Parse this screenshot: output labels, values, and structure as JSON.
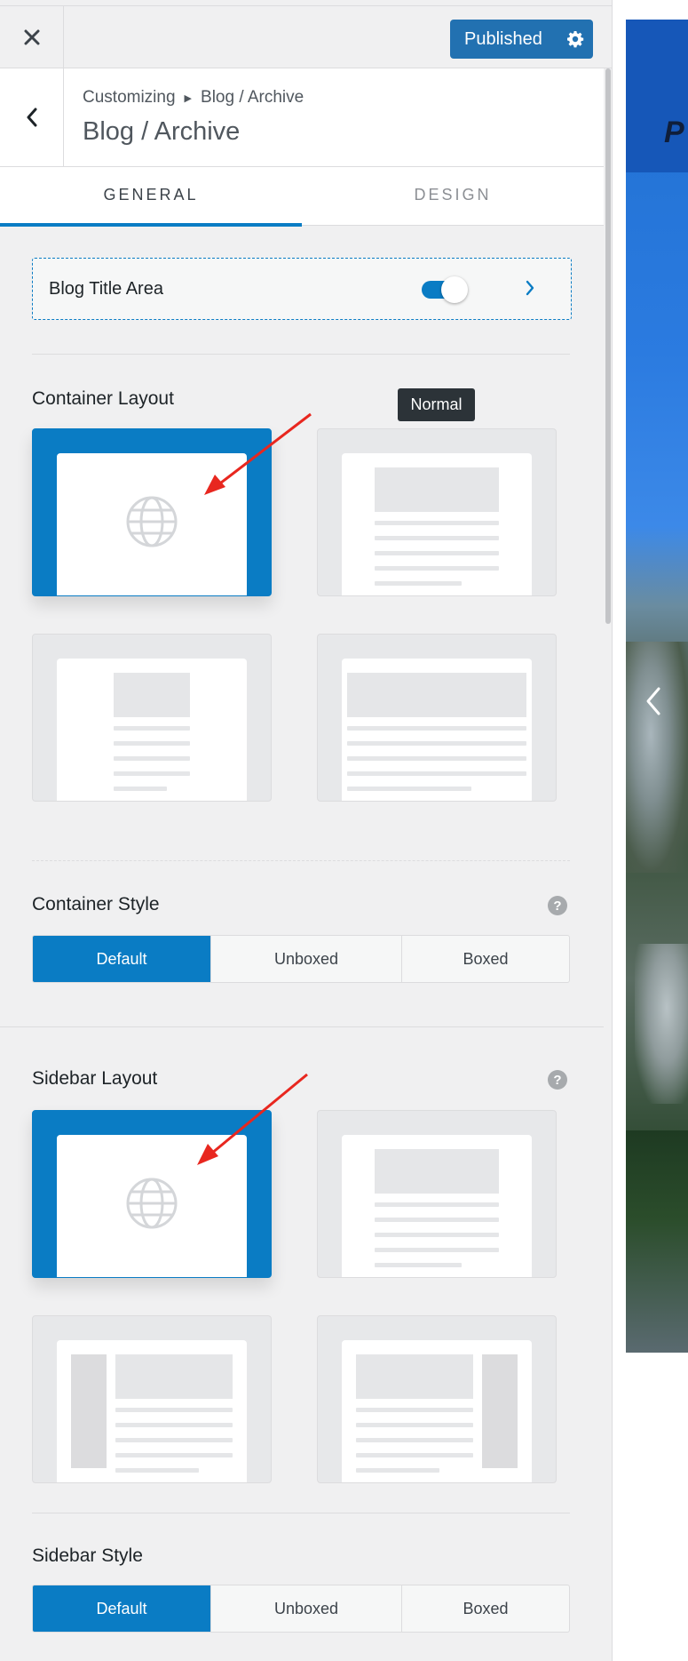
{
  "topbar": {
    "close_icon": "close-icon",
    "publish_label": "Published",
    "settings_icon": "gear-icon",
    "accent": "#2271b1"
  },
  "header": {
    "breadcrumb_root": "Customizing",
    "breadcrumb_current": "Blog / Archive",
    "title": "Blog / Archive",
    "back_icon": "chevron-left-icon"
  },
  "tabs": [
    {
      "label": "GENERAL",
      "active": true
    },
    {
      "label": "DESIGN",
      "active": false
    }
  ],
  "blog_title_area": {
    "label": "Blog Title Area",
    "toggle_on": true
  },
  "container_layout": {
    "label": "Container Layout",
    "tooltip": "Normal",
    "options": [
      {
        "icon": "globe-icon",
        "selected": true
      },
      {
        "icon": "layout-normal-icon",
        "selected": false
      },
      {
        "icon": "layout-narrow-icon",
        "selected": false
      },
      {
        "icon": "layout-full-icon",
        "selected": false
      }
    ]
  },
  "container_style": {
    "label": "Container Style",
    "options": [
      "Default",
      "Unboxed",
      "Boxed"
    ],
    "selected": "Default"
  },
  "sidebar_layout": {
    "label": "Sidebar Layout",
    "options": [
      {
        "icon": "globe-icon",
        "selected": true
      },
      {
        "icon": "layout-no-sidebar-icon",
        "selected": false
      },
      {
        "icon": "layout-left-sidebar-icon",
        "selected": false
      },
      {
        "icon": "layout-right-sidebar-icon",
        "selected": false
      }
    ]
  },
  "sidebar_style": {
    "label": "Sidebar Style",
    "options": [
      "Default",
      "Unboxed",
      "Boxed"
    ],
    "selected": "Default"
  },
  "colors": {
    "primary": "#0a7cc4",
    "panel_bg": "#f0f0f1",
    "annotation_arrow": "#e8271f"
  }
}
